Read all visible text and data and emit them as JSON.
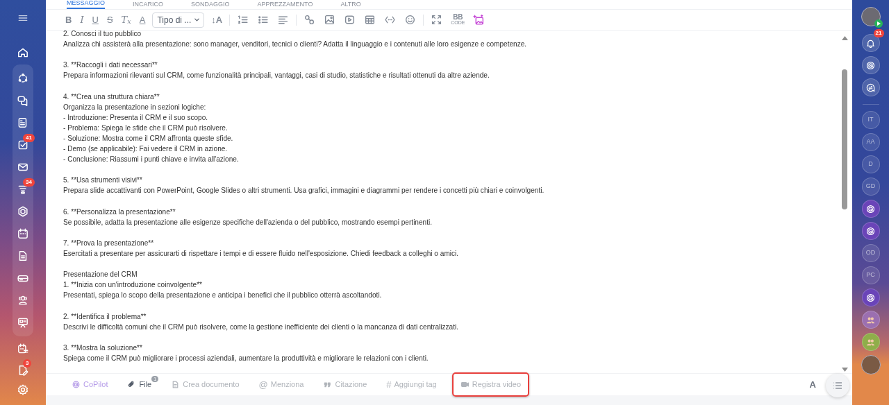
{
  "tabs": [
    {
      "label": "MESSAGGIO",
      "selected": true
    },
    {
      "label": "INCARICO",
      "selected": false
    },
    {
      "label": "SONDAGGIO",
      "selected": false
    },
    {
      "label": "APPREZZAMENTO",
      "selected": false
    },
    {
      "label": "ALTRO",
      "selected": false
    }
  ],
  "toolbar": [
    {
      "kind": "bold",
      "label": "B"
    },
    {
      "kind": "italic",
      "label": "I"
    },
    {
      "kind": "underline",
      "label": "U"
    },
    {
      "kind": "strike",
      "label": "S"
    },
    {
      "kind": "clearformat",
      "label": "T$_{x}$"
    },
    {
      "kind": "color",
      "label": "A"
    },
    {
      "kind": "select",
      "label": "Tipo di ..."
    },
    {
      "kind": "fontsize",
      "label": "↕A"
    },
    {
      "kind": "sep"
    },
    {
      "kind": "numbered"
    },
    {
      "kind": "bullets"
    },
    {
      "kind": "align"
    },
    {
      "kind": "sep"
    },
    {
      "kind": "link"
    },
    {
      "kind": "image"
    },
    {
      "kind": "video"
    },
    {
      "kind": "table"
    },
    {
      "kind": "code"
    },
    {
      "kind": "emoji"
    },
    {
      "kind": "sep"
    },
    {
      "kind": "fullscreen"
    },
    {
      "kind": "bbcode",
      "label": "BB",
      "sub": "CODE"
    },
    {
      "kind": "aiimage"
    }
  ],
  "paragraphs": [
    [
      "2.   Conosci il tuo pubblico",
      "Analizza chi assisterà alla presentazione: sono manager, venditori, tecnici o clienti? Adatta il linguaggio e i contenuti alle loro esigenze e competenze."
    ],
    [
      "3. **Raccogli i dati necessari**",
      "Prepara informazioni rilevanti sul CRM, come funzionalità principali, vantaggi, casi di studio, statistiche e risultati ottenuti da altre aziende."
    ],
    [
      "4. **Crea una struttura chiara**",
      "Organizza la presentazione in sezioni logiche:",
      "- Introduzione: Presenta il CRM e il suo scopo.",
      "- Problema: Spiega le sfide che il CRM può risolvere.",
      "- Soluzione: Mostra come il CRM affronta queste sfide.",
      "- Demo (se applicabile): Fai vedere il CRM in azione.",
      "- Conclusione: Riassumi i punti chiave e invita all'azione."
    ],
    [
      "5. **Usa strumenti visivi**",
      "Prepara slide accattivanti con PowerPoint, Google Slides o altri strumenti. Usa grafici, immagini e diagrammi per rendere i concetti più chiari e coinvolgenti."
    ],
    [
      "6. **Personalizza la presentazione**",
      "Se possibile, adatta la presentazione alle esigenze specifiche dell'azienda o del pubblico, mostrando esempi pertinenti."
    ],
    [
      "7. **Prova la presentazione**",
      "Esercitati a presentare per assicurarti di rispettare i tempi e di essere fluido nell'esposizione. Chiedi feedback a colleghi o amici."
    ],
    [
      "Presentazione del CRM",
      "1. **Inizia con un'introduzione coinvolgente**",
      "Presentati, spiega lo scopo della presentazione e anticipa i benefici che il pubblico otterrà ascoltandoti."
    ],
    [
      "2. **Identifica il problema**",
      "Descrivi le difficoltà comuni che il CRM può risolvere, come la gestione inefficiente dei clienti o la mancanza di dati centralizzati."
    ],
    [
      "3. **Mostra la soluzione**",
      "Spiega come il CRM può migliorare i processi aziendali, aumentare la produttività e migliorare le relazioni con i clienti."
    ]
  ],
  "actions": [
    {
      "kind": "copilot",
      "label": "CoPilot",
      "highlighted": false
    },
    {
      "kind": "file",
      "label": "File",
      "badge": "1",
      "highlighted": false
    },
    {
      "kind": "document",
      "label": "Crea documento",
      "highlighted": false
    },
    {
      "kind": "glyph",
      "glyph": "@",
      "label": "Menziona",
      "highlighted": false
    },
    {
      "kind": "quote",
      "label": "Citazione",
      "highlighted": false
    },
    {
      "kind": "glyph",
      "glyph": "#",
      "label": "Aggiungi tag",
      "highlighted": false
    },
    {
      "kind": "video",
      "label": "Registra video",
      "highlighted": true
    }
  ],
  "format_button": "A",
  "sidebar": {
    "top": [
      {
        "kind": "menu"
      },
      {
        "kind": "home"
      }
    ],
    "panel": [
      {
        "kind": "loop"
      },
      {
        "kind": "chat"
      },
      {
        "kind": "feed"
      },
      {
        "kind": "tasks",
        "badge": "41"
      },
      {
        "kind": "mail"
      },
      {
        "kind": "funnel",
        "badge": "34"
      },
      {
        "kind": "hexagon"
      },
      {
        "kind": "calendar"
      },
      {
        "kind": "document"
      },
      {
        "kind": "drive"
      },
      {
        "kind": "people"
      },
      {
        "kind": "board"
      }
    ],
    "bottom": [
      {
        "kind": "schedule"
      },
      {
        "kind": "sign",
        "badge": "3"
      },
      {
        "kind": "settings"
      }
    ]
  },
  "rightbar": [
    {
      "kind": "avatar"
    },
    {
      "kind": "bell",
      "badge": "21"
    },
    {
      "kind": "copilot"
    },
    {
      "kind": "chat-sync"
    },
    {
      "kind": "divider"
    },
    {
      "kind": "initials",
      "text": "IT"
    },
    {
      "kind": "initials",
      "text": "AA"
    },
    {
      "kind": "initials",
      "text": "D"
    },
    {
      "kind": "initials",
      "text": "GD"
    },
    {
      "kind": "copilot-chat"
    },
    {
      "kind": "copilot-chat"
    },
    {
      "kind": "initials",
      "text": "OD"
    },
    {
      "kind": "initials",
      "text": "PC"
    },
    {
      "kind": "copilot-chat"
    },
    {
      "kind": "group",
      "color": "#9b6fb0"
    },
    {
      "kind": "group",
      "color": "#8fae4a"
    },
    {
      "kind": "avatar"
    }
  ]
}
